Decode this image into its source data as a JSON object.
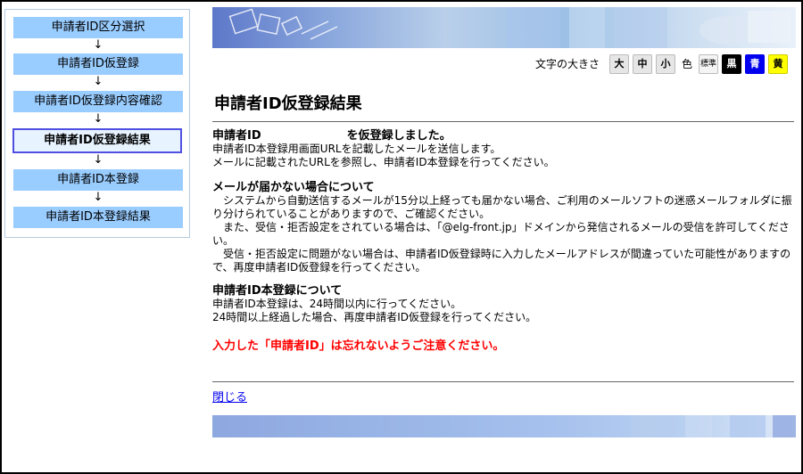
{
  "sidebar": {
    "steps": [
      {
        "label": "申請者ID区分選択"
      },
      {
        "label": "申請者ID仮登録"
      },
      {
        "label": "申請者ID仮登録内容確認"
      },
      {
        "label": "申請者ID仮登録結果"
      },
      {
        "label": "申請者ID本登録"
      },
      {
        "label": "申請者ID本登録結果"
      }
    ],
    "arrow": "↓",
    "current_index": 3
  },
  "controls": {
    "size_label": "文字の大きさ",
    "size_large": "大",
    "size_medium": "中",
    "size_small": "小",
    "color_label": "色",
    "color_standard": "標準",
    "color_black": "黒",
    "color_blue": "青",
    "color_yellow": "黄"
  },
  "main": {
    "title": "申請者ID仮登録結果",
    "registered": {
      "prefix": "申請者ID",
      "suffix": "を仮登録しました。",
      "line1": "申請者ID本登録用画面URLを記載したメールを送信します。",
      "line2": "メールに記載されたURLを参照し、申請者ID本登録を行ってください。"
    },
    "no_mail": {
      "heading": "メールが届かない場合について",
      "p1": "システムから自動送信するメールが15分以上経っても届かない場合、ご利用のメールソフトの迷惑メールフォルダに振り分けられていることがありますので、ご確認ください。",
      "p2": "また、受信・拒否設定をされている場合は、「@elg-front.jp」ドメインから発信されるメールの受信を許可してください。",
      "p3": "受信・拒否設定に問題がない場合は、申請者ID仮登録時に入力したメールアドレスが間違っていた可能性がありますので、再度申請者ID仮登録を行ってください。"
    },
    "main_reg": {
      "heading": "申請者ID本登録について",
      "line1": "申請者ID本登録は、24時間以内に行ってください。",
      "line2": "24時間以上経過した場合、再度申請者ID仮登録を行ってください。"
    },
    "warning": "入力した「申請者ID」は忘れないようご注意ください。",
    "close_link": "閉じる"
  },
  "colors": {
    "step_bg": "#99ccff",
    "current_step_border": "#5050e0",
    "warning": "#ff0000",
    "link": "#0000ee"
  }
}
